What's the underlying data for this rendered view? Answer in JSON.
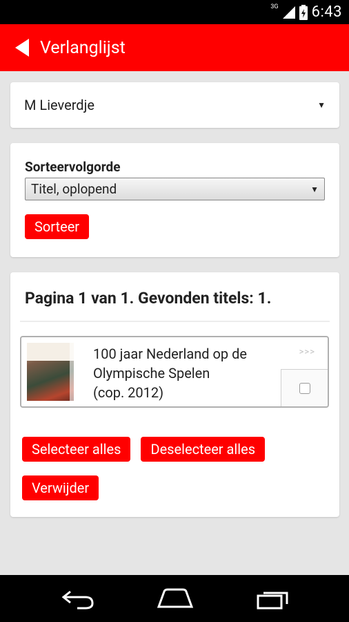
{
  "status_bar": {
    "time": "6:43",
    "network": "3G"
  },
  "action_bar": {
    "title": "Verlanglijst"
  },
  "list_selector": {
    "selected": "M Lieverdje"
  },
  "sort": {
    "label": "Sorteervolgorde",
    "selected": "Titel, oplopend",
    "button": "Sorteer"
  },
  "results": {
    "summary": "Pagina 1 van 1. Gevonden titels: 1.",
    "items": [
      {
        "title_line1": "100 jaar Nederland op de",
        "title_line2": "Olympische Spelen",
        "title_line3": "(cop. 2012)",
        "more": ">>>"
      }
    ],
    "select_all": "Selecteer alles",
    "deselect_all": "Deselecteer alles",
    "remove": "Verwijder"
  }
}
